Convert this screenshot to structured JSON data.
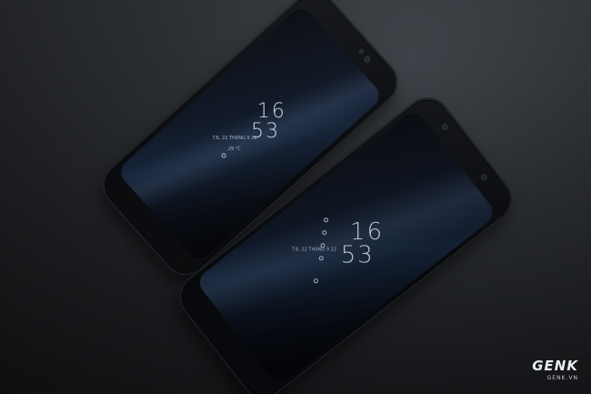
{
  "phones": [
    {
      "name": "rear-left-phone",
      "clock_hour": "16",
      "clock_minute": "53",
      "date_line": "T.6, 22 THÁNG 9 22",
      "weather_line": "29 °C"
    },
    {
      "name": "front-right-phone",
      "clock_hour": "16",
      "clock_minute": "53",
      "date_line": "T.6, 22 THÁNG 9 22",
      "weather_line": ""
    }
  ],
  "watermark": {
    "logo": "GENK",
    "site": "GENK.VN"
  },
  "colors": {
    "table": "#25282c",
    "phone_body": "#0a0b0e",
    "screen_highlight": "#14233a"
  }
}
